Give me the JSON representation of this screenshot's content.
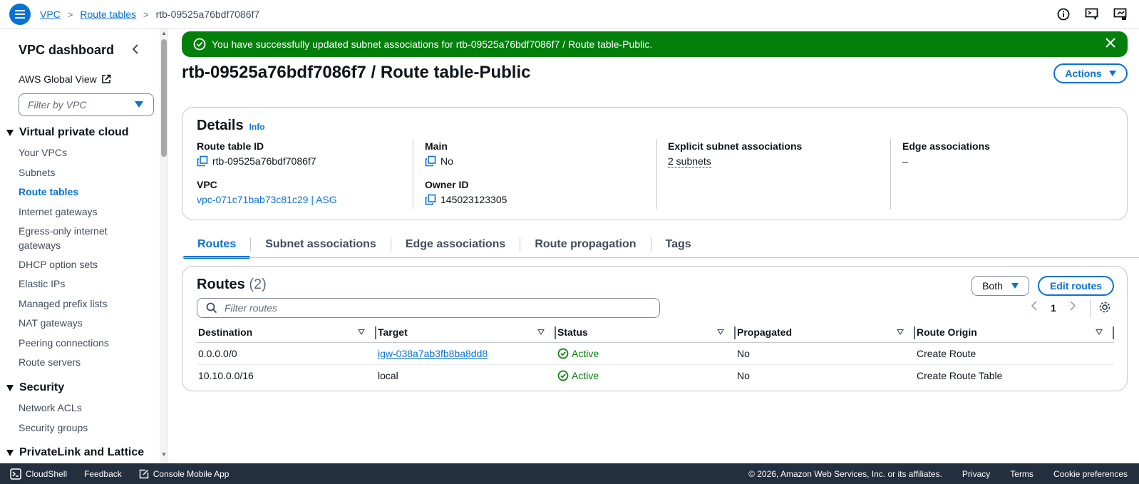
{
  "breadcrumb": {
    "items": [
      "VPC",
      "Route tables"
    ],
    "current": "rtb-09525a76bdf7086f7"
  },
  "sidebar": {
    "title": "VPC dashboard",
    "global_view": "AWS Global View",
    "filter_placeholder": "Filter by VPC",
    "sections": [
      {
        "title": "Virtual private cloud"
      },
      {
        "title": "Security"
      },
      {
        "title": "PrivateLink and Lattice"
      }
    ],
    "vpc_items": [
      "Your VPCs",
      "Subnets",
      "Route tables",
      "Internet gateways",
      "Egress-only internet",
      "gateways",
      "DHCP option sets",
      "Elastic IPs",
      "Managed prefix lists",
      "NAT gateways",
      "Peering connections",
      "Route servers"
    ],
    "security_items": [
      "Network ACLs",
      "Security groups"
    ]
  },
  "flash": {
    "message": "You have successfully updated subnet associations for rtb-09525a76bdf7086f7 / Route table-Public."
  },
  "page": {
    "title": "rtb-09525a76bdf7086f7 / Route table-Public",
    "actions_label": "Actions"
  },
  "details": {
    "heading": "Details",
    "info": "Info",
    "route_table_id_label": "Route table ID",
    "route_table_id": "rtb-09525a76bdf7086f7",
    "vpc_label": "VPC",
    "vpc_value": "vpc-071c71bab73c81c29 | ASG",
    "main_label": "Main",
    "main_value": "No",
    "owner_label": "Owner ID",
    "owner_value": "145023123305",
    "explicit_label": "Explicit subnet associations",
    "explicit_value": "2 subnets",
    "edge_label": "Edge associations",
    "edge_value": "–"
  },
  "tabs": [
    "Routes",
    "Subnet associations",
    "Edge associations",
    "Route propagation",
    "Tags"
  ],
  "routes": {
    "heading": "Routes",
    "count": "(2)",
    "both_label": "Both",
    "edit_label": "Edit routes",
    "filter_placeholder": "Filter routes",
    "page": "1",
    "columns": [
      "Destination",
      "Target",
      "Status",
      "Propagated",
      "Route Origin"
    ],
    "rows": [
      {
        "destination": "0.0.0.0/0",
        "target": "igw-038a7ab3fb8ba8dd8",
        "status": "Active",
        "propagated": "No",
        "origin": "Create Route"
      },
      {
        "destination": "10.10.0.0/16",
        "target": "local",
        "status": "Active",
        "propagated": "No",
        "origin": "Create Route Table"
      }
    ]
  },
  "footer": {
    "cloudshell": "CloudShell",
    "feedback": "Feedback",
    "mobile": "Console Mobile App",
    "copyright": "© 2026, Amazon Web Services, Inc. or its affiliates.",
    "privacy": "Privacy",
    "terms": "Terms",
    "cookies": "Cookie preferences"
  },
  "colors": {
    "accent": "#0972d3",
    "success": "#037f0c",
    "footer_bg": "#232f3e"
  }
}
